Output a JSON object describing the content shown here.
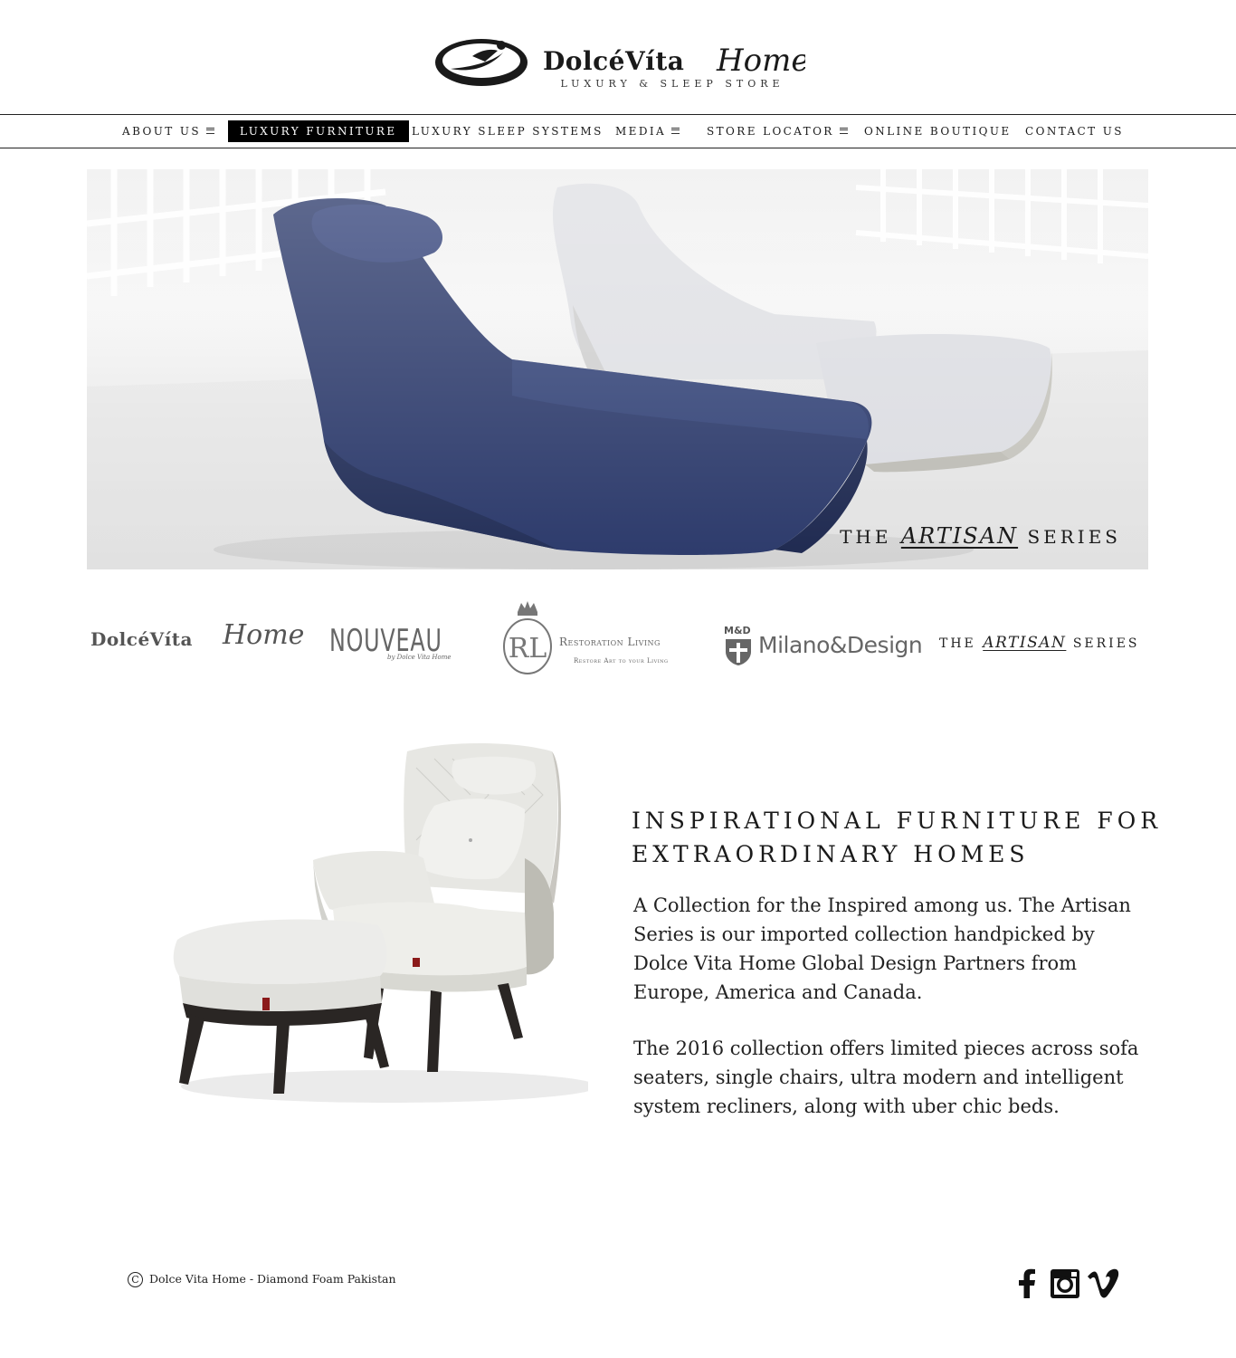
{
  "header": {
    "logo_primary": "DolcéVíta",
    "logo_script": "Home",
    "tagline": "LUXURY & SLEEP STORE"
  },
  "nav": {
    "items": [
      {
        "label": "ABOUT US",
        "has_menu": true
      },
      {
        "label": "LUXURY FURNITURE",
        "active": true
      },
      {
        "label": "LUXURY SLEEP SYSTEMS"
      },
      {
        "label": "MEDIA",
        "has_menu": true
      },
      {
        "label": "STORE LOCATOR",
        "has_menu": true
      },
      {
        "label": "ONLINE BOUTIQUE"
      },
      {
        "label": "CONTACT US"
      }
    ]
  },
  "hero": {
    "caption_pre": "THE",
    "caption_em": "ARTISAN",
    "caption_post": "SERIES"
  },
  "brands": {
    "dolce_vita_primary": "DolcéVíta",
    "dolce_vita_script": "Home",
    "nouveau": "NOUVEAU",
    "nouveau_sub": "by Dolce Vita Home",
    "restoration_monogram": "RL",
    "restoration_name": "Restoration Living",
    "restoration_sub": "Restore Art to your Living",
    "milano_mark": "M&D",
    "milano_name": "Milano&Design",
    "artisan_pre": "THE",
    "artisan_em": "ARTISAN",
    "artisan_post": "SERIES"
  },
  "content": {
    "headline": "INSPIRATIONAL FURNITURE FOR EXTRAORDINARY HOMES",
    "paragraph1": "A Collection for the Inspired among us. The Artisan Series is our imported collection handpicked by Dolce Vita Home Global Design Partners from Europe, America and Canada.",
    "paragraph2": "The 2016 collection offers limited pieces across sofa seaters, single chairs, ultra modern and intelligent system recliners, along with uber chic beds."
  },
  "footer": {
    "copyright_symbol": "C",
    "copyright_text": "Dolce Vita Home - Diamond Foam Pakistan",
    "social": [
      "facebook-icon",
      "instagram-icon",
      "vimeo-icon"
    ]
  },
  "colors": {
    "nav_active_bg": "#000000",
    "sofa_blue": "#2c3a6b",
    "sofa_grey": "#dcdde1"
  }
}
